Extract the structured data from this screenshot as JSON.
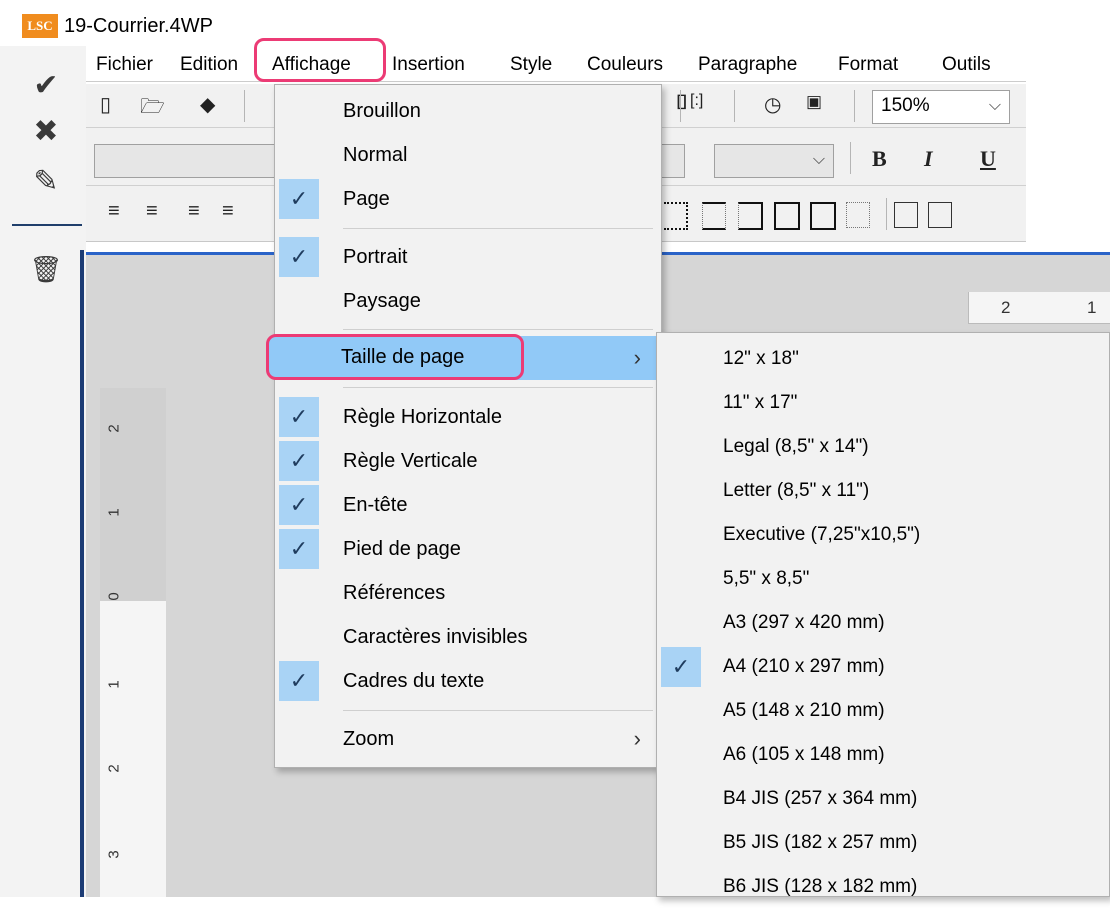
{
  "window": {
    "title": "19-Courrier.4WP",
    "logo_text": "LSC"
  },
  "menubar": {
    "items": [
      "Fichier",
      "Edition",
      "Affichage",
      "Insertion",
      "Style",
      "Couleurs",
      "Paragraphe",
      "Format",
      "Outils"
    ],
    "active": "Affichage"
  },
  "toolbar": {
    "zoom_value": "150%",
    "bold_label": "B",
    "italic_label": "I",
    "underline_label": "U"
  },
  "leftbar": {
    "icons": [
      "check-icon",
      "close-icon",
      "pencil-icon",
      "trash-icon"
    ]
  },
  "affichage_menu": {
    "items": [
      {
        "label": "Brouillon",
        "checked": false
      },
      {
        "label": "Normal",
        "checked": false
      },
      {
        "label": "Page",
        "checked": true
      },
      {
        "label": "Portrait",
        "checked": true
      },
      {
        "label": "Paysage",
        "checked": false
      },
      {
        "label": "Taille de page",
        "checked": false,
        "submenu": true,
        "highlighted": true
      },
      {
        "label": "Règle Horizontale",
        "checked": true
      },
      {
        "label": "Règle Verticale",
        "checked": true
      },
      {
        "label": "En-tête",
        "checked": true
      },
      {
        "label": "Pied de page",
        "checked": true
      },
      {
        "label": "Références",
        "checked": false
      },
      {
        "label": "Caractères invisibles",
        "checked": false
      },
      {
        "label": "Cadres du texte",
        "checked": true
      },
      {
        "label": "Zoom",
        "checked": false,
        "submenu": true
      }
    ]
  },
  "taille_submenu": {
    "items": [
      {
        "label": "12\" x 18\"",
        "checked": false
      },
      {
        "label": "11\" x 17\"",
        "checked": false
      },
      {
        "label": "Legal (8,5\" x 14\")",
        "checked": false
      },
      {
        "label": "Letter (8,5\" x 11\")",
        "checked": false
      },
      {
        "label": "Executive (7,25\"x10,5\")",
        "checked": false
      },
      {
        "label": "5,5\" x 8,5\"",
        "checked": false
      },
      {
        "label": "A3 (297 x 420 mm)",
        "checked": false
      },
      {
        "label": "A4 (210 x 297 mm)",
        "checked": true
      },
      {
        "label": "A5 (148 x 210 mm)",
        "checked": false
      },
      {
        "label": "A6 (105 x 148 mm)",
        "checked": false
      },
      {
        "label": "B4 JIS (257 x 364 mm)",
        "checked": false
      },
      {
        "label": "B5 JIS (182 x 257 mm)",
        "checked": false
      },
      {
        "label": "B6 JIS (128 x 182 mm)",
        "checked": false
      }
    ]
  },
  "rulers": {
    "horizontal_numbers": [
      "2",
      "1"
    ],
    "vertical_numbers": [
      "2",
      "1",
      "0",
      "1",
      "2",
      "3"
    ]
  },
  "colors": {
    "highlight": "#91c9f7",
    "check_bg": "#a9d3f5",
    "annotation": "#ec3b75",
    "logo": "#f08c1e"
  }
}
